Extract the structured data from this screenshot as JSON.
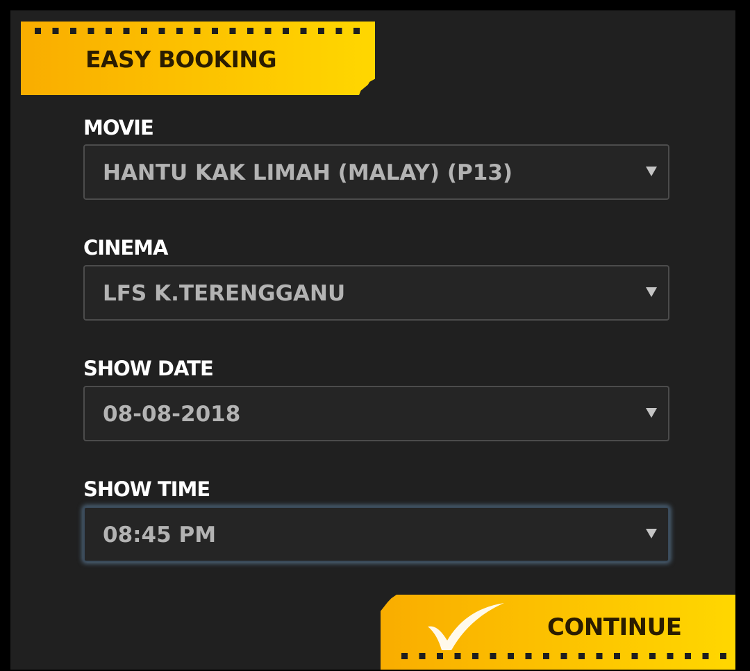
{
  "banner": {
    "title": "EASY BOOKING"
  },
  "form": {
    "movie": {
      "label": "MOVIE",
      "value": "HANTU KAK LIMAH (MALAY) (P13)"
    },
    "cinema": {
      "label": "CINEMA",
      "value": "LFS K.TERENGGANU"
    },
    "show_date": {
      "label": "SHOW DATE",
      "value": "08-08-2018"
    },
    "show_time": {
      "label": "SHOW TIME",
      "value": "08:45 PM"
    }
  },
  "continue_button": {
    "label": "CONTINUE",
    "icon": "check-icon"
  },
  "colors": {
    "background": "#202020",
    "accent_start": "#f9ad00",
    "accent_end": "#ffd700",
    "label": "#ffffff",
    "value_text": "#b3b3b3",
    "focus_glow": "#78a5cd"
  }
}
